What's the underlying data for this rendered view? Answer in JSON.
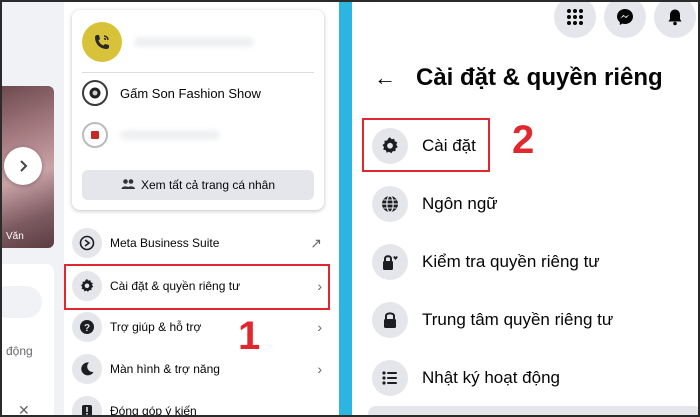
{
  "left_panel": {
    "feed": {
      "story_name": "Văn",
      "side_text": "động"
    },
    "profiles": {
      "second_profile_name": "Gấm Son Fashion Show",
      "see_all_label": "Xem tất cả trang cá nhân"
    },
    "menu_items": [
      {
        "label": "Meta Business Suite",
        "icon": "meta-business-icon",
        "trailing": "↗"
      },
      {
        "label": "Cài đặt & quyền riêng tư",
        "icon": "gear-icon",
        "trailing": "›"
      },
      {
        "label": "Trợ giúp & hỗ trợ",
        "icon": "help-icon",
        "trailing": "›"
      },
      {
        "label": "Màn hình & trợ năng",
        "icon": "moon-icon",
        "trailing": "›"
      },
      {
        "label": "Đóng góp ý kiến",
        "icon": "feedback-icon",
        "trailing": ""
      }
    ],
    "step_number": "1"
  },
  "right_panel": {
    "title": "Cài đặt & quyền riêng",
    "items": [
      {
        "label": "Cài đặt",
        "icon": "gear-icon"
      },
      {
        "label": "Ngôn ngữ",
        "icon": "globe-icon"
      },
      {
        "label": "Kiểm tra quyền riêng tư",
        "icon": "lock-heart-icon"
      },
      {
        "label": "Trung tâm quyền riêng tư",
        "icon": "lock-icon"
      },
      {
        "label": "Nhật ký hoạt động",
        "icon": "list-icon"
      }
    ],
    "step_number": "2"
  },
  "colors": {
    "highlight_red": "#e0282e",
    "divider_blue": "#2bb5e0",
    "icon_bg": "#e4e6eb"
  }
}
